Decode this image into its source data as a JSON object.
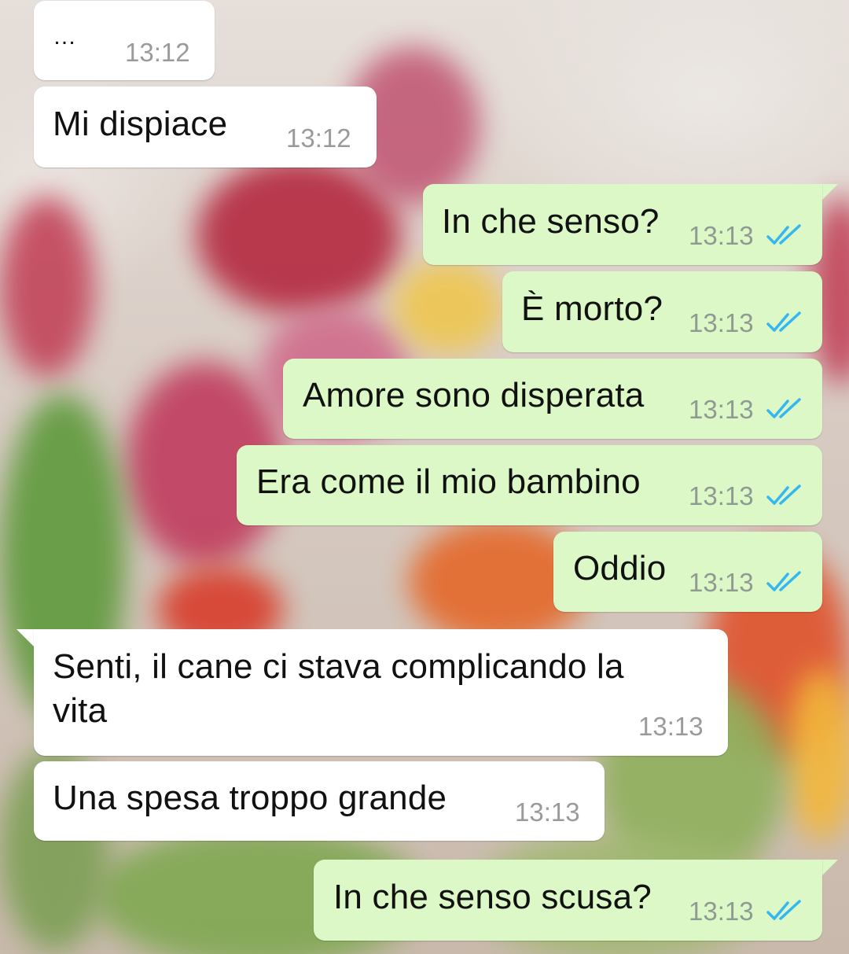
{
  "theme": {
    "incoming_bubble": "#ffffff",
    "outgoing_bubble": "#dcf8c6",
    "timestamp_color": "#9a9a9a",
    "read_receipt_color": "#34b7f1"
  },
  "messages": [
    {
      "direction": "incoming",
      "text": "…",
      "time": "13:12"
    },
    {
      "direction": "incoming",
      "text": "Mi dispiace",
      "time": "13:12"
    },
    {
      "direction": "outgoing",
      "text": "In che senso?",
      "time": "13:13",
      "status": "read-double-check-icon"
    },
    {
      "direction": "outgoing",
      "text": "È morto?",
      "time": "13:13",
      "status": "read-double-check-icon"
    },
    {
      "direction": "outgoing",
      "text": "Amore sono disperata",
      "time": "13:13",
      "status": "read-double-check-icon"
    },
    {
      "direction": "outgoing",
      "text": "Era come il mio bambino",
      "time": "13:13",
      "status": "read-double-check-icon"
    },
    {
      "direction": "outgoing",
      "text": "Oddio",
      "time": "13:13",
      "status": "read-double-check-icon"
    },
    {
      "direction": "incoming",
      "text": "Senti, il cane ci stava complicando la\nvita",
      "time": "13:13"
    },
    {
      "direction": "incoming",
      "text": "Una spesa troppo grande",
      "time": "13:13"
    },
    {
      "direction": "outgoing",
      "text": "In che senso scusa?",
      "time": "13:13",
      "status": "read-double-check-icon"
    }
  ]
}
